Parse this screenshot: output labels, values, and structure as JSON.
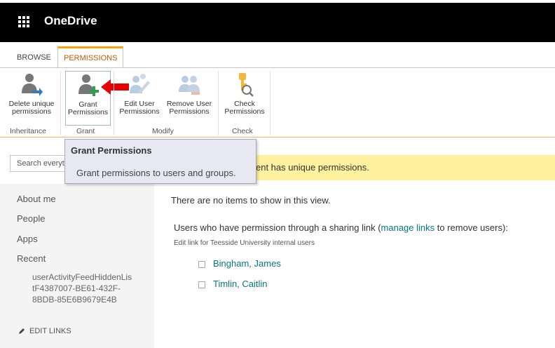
{
  "app": {
    "title": "OneDrive"
  },
  "tabs": [
    {
      "label": "BROWSE"
    },
    {
      "label": "PERMISSIONS"
    }
  ],
  "ribbon": {
    "buttons": [
      {
        "label_line1": "Delete unique",
        "label_line2": "permissions"
      },
      {
        "label_line1": "Grant",
        "label_line2": "Permissions"
      },
      {
        "label_line1": "Edit User",
        "label_line2": "Permissions"
      },
      {
        "label_line1": "Remove User",
        "label_line2": "Permissions"
      },
      {
        "label_line1": "Check",
        "label_line2": "Permissions"
      }
    ],
    "groups": [
      {
        "label": "Inheritance"
      },
      {
        "label": "Grant"
      },
      {
        "label": "Modify"
      },
      {
        "label": "Check"
      }
    ]
  },
  "tooltip": {
    "title": "Grant Permissions",
    "description": "Grant permissions to users and groups."
  },
  "search": {
    "text": "Search everyt"
  },
  "banner": {
    "text": "ent has unique permissions."
  },
  "nav": {
    "items": [
      {
        "label": "About me"
      },
      {
        "label": "People"
      },
      {
        "label": "Apps"
      },
      {
        "label": "Recent"
      }
    ],
    "recent_sub": "userActivityFeedHiddenListF4387007-BE61-432F-8BDB-85E6B9679E4B",
    "recent_sub_lines": [
      "userActivityFeedHiddenLis",
      "tF4387007-BE61-432F-",
      "8BDB-85E6B9679E4B"
    ],
    "edit_links": "EDIT LINKS"
  },
  "main": {
    "empty_message": "There are no items to show in this view.",
    "share_prefix": "Users who have permission through a sharing link (",
    "share_link": "manage links",
    "share_suffix": " to remove users):",
    "edit_link_note": "Edit link for Teesside University internal users",
    "users": [
      {
        "name": "Bingham, James"
      },
      {
        "name": "Timlin, Caitlin"
      }
    ]
  },
  "colors": {
    "accent_orange": "#f8a50c",
    "link_teal": "#03787c",
    "banner_yellow": "#fff19d",
    "arrow_red": "#e60000"
  }
}
